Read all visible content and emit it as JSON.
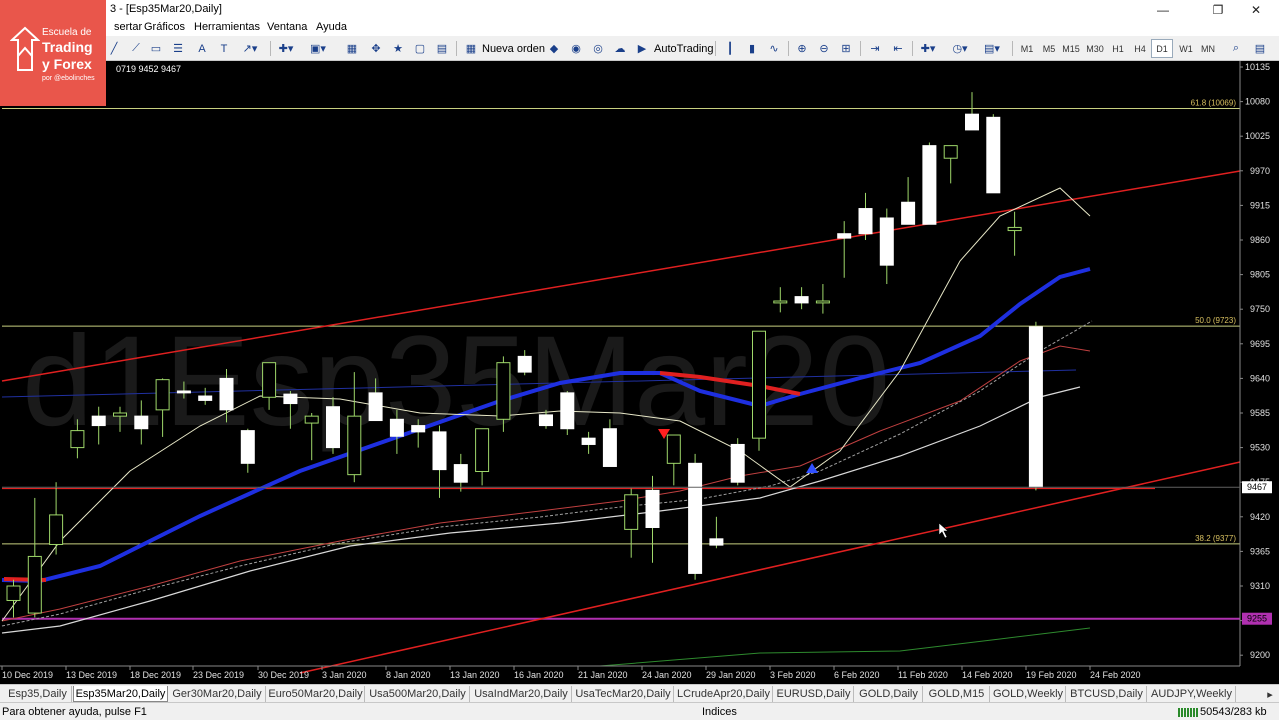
{
  "window": {
    "title_partial": "3 - [Esp35Mar20,Daily]",
    "minimize": "—",
    "restore": "❐",
    "close": "✕"
  },
  "logo": {
    "line1": "Escuela de",
    "line2": "Trading",
    "line3": "y Forex",
    "line4": "por @ebolinches"
  },
  "menu": {
    "items": [
      "sertar",
      "Gráficos",
      "Herramientas",
      "Ventana",
      "Ayuda"
    ]
  },
  "toolbar": {
    "new_order": "Nueva orden",
    "autotrading": "AutoTrading",
    "timeframes": [
      "M1",
      "M5",
      "M15",
      "M30",
      "H1",
      "H4",
      "D1",
      "W1",
      "MN"
    ],
    "selected_timeframe": "D1"
  },
  "chart": {
    "info_line": "0719 9452 9467",
    "watermark": "d1Esp35Mar20",
    "background": "#000000",
    "fib_labels": [
      "61.8 (10069)",
      "50.0 (9723)",
      "38.2 (9377)"
    ],
    "price_ticks": [
      "10135",
      "10080",
      "10025",
      "9970",
      "9915",
      "9860",
      "9805",
      "9750",
      "9695",
      "9640",
      "9585",
      "9530",
      "9475",
      "9420",
      "9365",
      "9310",
      "9255",
      "9200"
    ],
    "current_price": "9467",
    "magenta_level_label": "9255",
    "date_ticks": [
      "10 Dec 2019",
      "13 Dec 2019",
      "18 Dec 2019",
      "23 Dec 2019",
      "30 Dec 2019",
      "3 Jan 2020",
      "8 Jan 2020",
      "13 Jan 2020",
      "16 Jan 2020",
      "21 Jan 2020",
      "24 Jan 2020",
      "29 Jan 2020",
      "3 Feb 2020",
      "6 Feb 2020",
      "11 Feb 2020",
      "14 Feb 2020",
      "19 Feb 2020",
      "24 Feb 2020"
    ]
  },
  "chart_data": {
    "type": "candlestick",
    "symbol": "Esp35Mar20",
    "timeframe": "Daily",
    "ylim": [
      9180,
      10150
    ],
    "fib_levels": [
      10069,
      9723,
      9377
    ],
    "candles": [
      {
        "o": 9287,
        "h": 9320,
        "l": 9260,
        "c": 9310
      },
      {
        "o": 9267,
        "h": 9450,
        "l": 9260,
        "c": 9357
      },
      {
        "o": 9376,
        "h": 9475,
        "l": 9360,
        "c": 9423
      },
      {
        "o": 9530,
        "h": 9575,
        "l": 9513,
        "c": 9557
      },
      {
        "o": 9580,
        "h": 9595,
        "l": 9535,
        "c": 9565
      },
      {
        "o": 9580,
        "h": 9595,
        "l": 9555,
        "c": 9585
      },
      {
        "o": 9580,
        "h": 9605,
        "l": 9535,
        "c": 9560
      },
      {
        "o": 9590,
        "h": 9640,
        "l": 9547,
        "c": 9638
      },
      {
        "o": 9620,
        "h": 9635,
        "l": 9608,
        "c": 9617
      },
      {
        "o": 9612,
        "h": 9625,
        "l": 9598,
        "c": 9605
      },
      {
        "o": 9640,
        "h": 9655,
        "l": 9570,
        "c": 9590
      },
      {
        "o": 9557,
        "h": 9560,
        "l": 9490,
        "c": 9505
      },
      {
        "o": 9610,
        "h": 9660,
        "l": 9590,
        "c": 9665
      },
      {
        "o": 9615,
        "h": 9620,
        "l": 9560,
        "c": 9600
      },
      {
        "o": 9569,
        "h": 9585,
        "l": 9510,
        "c": 9580
      },
      {
        "o": 9595,
        "h": 9610,
        "l": 9520,
        "c": 9530
      },
      {
        "o": 9487,
        "h": 9650,
        "l": 9475,
        "c": 9580
      },
      {
        "o": 9617,
        "h": 9640,
        "l": 9580,
        "c": 9573
      },
      {
        "o": 9575,
        "h": 9590,
        "l": 9520,
        "c": 9548
      },
      {
        "o": 9565,
        "h": 9575,
        "l": 9530,
        "c": 9555
      },
      {
        "o": 9555,
        "h": 9565,
        "l": 9450,
        "c": 9495
      },
      {
        "o": 9503,
        "h": 9520,
        "l": 9460,
        "c": 9475
      },
      {
        "o": 9492,
        "h": 9560,
        "l": 9470,
        "c": 9560
      },
      {
        "o": 9575,
        "h": 9675,
        "l": 9555,
        "c": 9665
      },
      {
        "o": 9675,
        "h": 9685,
        "l": 9645,
        "c": 9650
      },
      {
        "o": 9582,
        "h": 9590,
        "l": 9560,
        "c": 9565
      },
      {
        "o": 9617,
        "h": 9620,
        "l": 9550,
        "c": 9560
      },
      {
        "o": 9545,
        "h": 9555,
        "l": 9520,
        "c": 9535
      },
      {
        "o": 9560,
        "h": 9575,
        "l": 9510,
        "c": 9500
      },
      {
        "o": 9400,
        "h": 9465,
        "l": 9355,
        "c": 9455
      },
      {
        "o": 9462,
        "h": 9485,
        "l": 9347,
        "c": 9403
      },
      {
        "o": 9505,
        "h": 9530,
        "l": 9470,
        "c": 9550
      },
      {
        "o": 9505,
        "h": 9520,
        "l": 9320,
        "c": 9330
      },
      {
        "o": 9385,
        "h": 9420,
        "l": 9370,
        "c": 9375
      },
      {
        "o": 9535,
        "h": 9545,
        "l": 9470,
        "c": 9475
      },
      {
        "o": 9545,
        "h": 9715,
        "l": 9525,
        "c": 9715
      },
      {
        "o": 9760,
        "h": 9785,
        "l": 9745,
        "c": 9763
      },
      {
        "o": 9770,
        "h": 9785,
        "l": 9750,
        "c": 9760
      },
      {
        "o": 9760,
        "h": 9790,
        "l": 9743,
        "c": 9763
      },
      {
        "o": 9870,
        "h": 9890,
        "l": 9800,
        "c": 9863
      },
      {
        "o": 9910,
        "h": 9935,
        "l": 9860,
        "c": 9870
      },
      {
        "o": 9895,
        "h": 9910,
        "l": 9790,
        "c": 9820
      },
      {
        "o": 9920,
        "h": 9960,
        "l": 9885,
        "c": 9885
      },
      {
        "o": 10010,
        "h": 10015,
        "l": 9890,
        "c": 9885
      },
      {
        "o": 9990,
        "h": 10010,
        "l": 9950,
        "c": 10010
      },
      {
        "o": 10060,
        "h": 10095,
        "l": 10035,
        "c": 10035
      },
      {
        "o": 10055,
        "h": 10060,
        "l": 9935,
        "c": 9935
      },
      {
        "o": 9875,
        "h": 9905,
        "l": 9835,
        "c": 9880
      },
      {
        "o": 9722,
        "h": 9730,
        "l": 9462,
        "c": 9467
      }
    ]
  },
  "tabs": {
    "items": [
      "Esp35,Daily",
      "Esp35Mar20,Daily",
      "Ger30Mar20,Daily",
      "Euro50Mar20,Daily",
      "Usa500Mar20,Daily",
      "UsaIndMar20,Daily",
      "UsaTecMar20,Daily",
      "LCrudeApr20,Daily",
      "EURUSD,Daily",
      "GOLD,Daily",
      "GOLD,M15",
      "GOLD,Weekly",
      "BTCUSD,Daily",
      "AUDJPY,Weekly"
    ],
    "active_index": 1
  },
  "status": {
    "help": "Para obtener ayuda, pulse F1",
    "profile": "Indices",
    "traffic": "50543/283 kb"
  },
  "colors": {
    "ma_fast": "#1e2fe0",
    "ma_down": "#e02020",
    "trend_line": "#e02020",
    "fib_line": "#c8d080",
    "magenta": "#b030b0"
  }
}
